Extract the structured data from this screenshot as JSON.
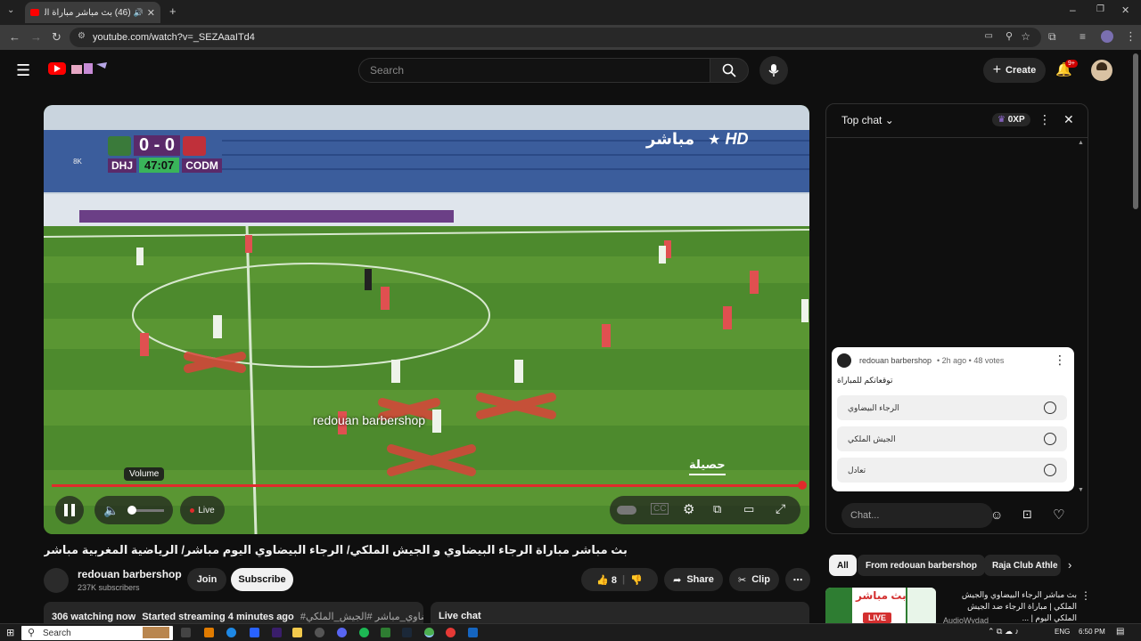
{
  "browser": {
    "tab_title": "(46) بث مباشر مباراة الرجاء البيضاوي",
    "url": "youtube.com/watch?v=_SEZAaaITd4"
  },
  "header": {
    "search_placeholder": "Search",
    "create_label": "Create",
    "notifications_badge": "9+"
  },
  "video": {
    "scoreboard": {
      "home_team": "DHJ",
      "away_team": "CODM",
      "score": "0 - 0",
      "clock": "47:07",
      "channel_badge": "8K"
    },
    "broadcaster_label": "مباشر",
    "broadcaster_hd": "HD",
    "watermark": "redouan barbershop",
    "corner_label": "حصيلة",
    "volume_tooltip": "Volume",
    "live_label": "Live",
    "progress_fraction": 1.0
  },
  "chat": {
    "header_label": "Top chat",
    "xp_label": "0XP",
    "poll": {
      "author": "redouan barbershop",
      "meta": "• 2h ago • 48 votes",
      "question": "توقعاتكم للمباراة",
      "options": [
        "الرجاء البيضاوي",
        "الجيش الملكي",
        "تعادل"
      ]
    },
    "input_placeholder": "Chat..."
  },
  "below": {
    "title": "بث مباشر مباراة الرجاء البيضاوي و الجيش الملكي/ الرجاء البيضاوي اليوم مباشر/ الرياضية المغربية مباشر",
    "channel_name": "redouan barbershop",
    "subscribers": "237K subscribers",
    "join_label": "Join",
    "subscribe_label": "Subscribe",
    "like_count": "8",
    "share_label": "Share",
    "clip_label": "Clip",
    "watching": "306 watching now",
    "started": "Started streaming 4 minutes ago",
    "hashtags": "#الرجاء_البيضاوي_مباشر #الجيش_الملكي",
    "live_chat_label": "Live chat"
  },
  "recommendations": {
    "chips": [
      "All",
      "From redouan barbershop",
      "Raja Club Athle"
    ],
    "item": {
      "title": "بث مباشر الرجاء البيضاوي والجيش الملكي | مباراة الرجاء ضد الجيش الملكي اليوم | ...",
      "channel": "AudioWydad",
      "thumb_text": "بث مباشر",
      "thumb_live": "LIVE"
    }
  },
  "taskbar": {
    "search_label": "Search",
    "language": "ENG",
    "time": "6:50 PM"
  },
  "colors": {
    "accent_red": "#ff0000",
    "progress_red": "#e02b2b",
    "pitch_green": "#3f7a2a",
    "score_purple": "#5a2a6a",
    "clock_green": "#3ab45a"
  }
}
